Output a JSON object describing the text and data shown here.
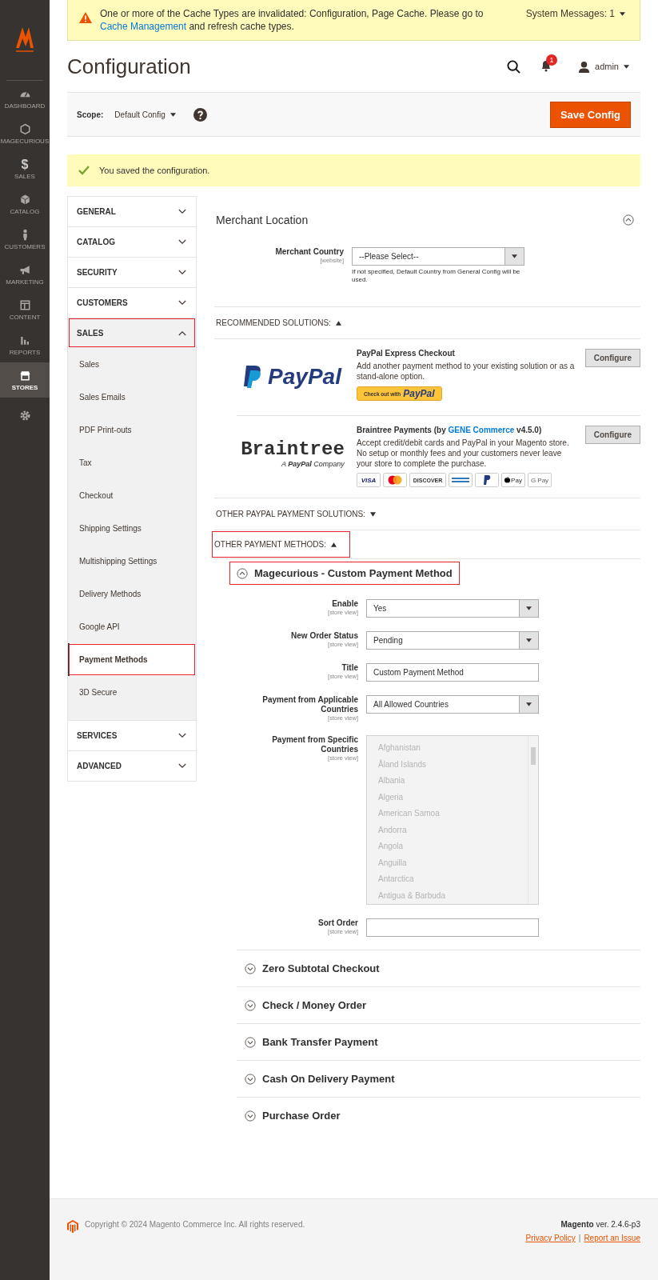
{
  "nav": {
    "items": [
      {
        "label": "DASHBOARD",
        "selected": false
      },
      {
        "label": "MAGECURIOUS",
        "selected": false
      },
      {
        "glyph": "$",
        "label": "SALES",
        "selected": false
      },
      {
        "label": "CATALOG",
        "selected": false
      },
      {
        "label": "CUSTOMERS",
        "selected": false
      },
      {
        "label": "MARKETING",
        "selected": false
      },
      {
        "label": "CONTENT",
        "selected": false
      },
      {
        "label": "REPORTS",
        "selected": false
      },
      {
        "label": "STORES",
        "selected": true
      },
      {
        "selected": false
      }
    ]
  },
  "system_message": {
    "text": "One or more of the Cache Types are invalidated: Configuration, Page Cache. Please go to",
    "link": "Cache Management",
    "text_end": "and refresh cache types.",
    "counter": "System Messages: 1"
  },
  "header": {
    "title": "Configuration",
    "notifications": "1",
    "user": "admin"
  },
  "scope": {
    "label": "Scope:",
    "value": "Default Config",
    "save_button": "Save Config"
  },
  "success_message": "You saved the configuration.",
  "config_nav": [
    {
      "label": "GENERAL",
      "expanded": false,
      "highlighted": false
    },
    {
      "label": "CATALOG",
      "expanded": false,
      "highlighted": false
    },
    {
      "label": "SECURITY",
      "expanded": false,
      "highlighted": false
    },
    {
      "label": "CUSTOMERS",
      "expanded": false,
      "highlighted": false
    },
    {
      "label": "SALES",
      "expanded": true,
      "highlighted": true,
      "children": [
        {
          "label": "Sales",
          "selected": false,
          "highlighted": false
        },
        {
          "label": "Sales Emails",
          "selected": false,
          "highlighted": false
        },
        {
          "label": "PDF Print-outs",
          "selected": false,
          "highlighted": false
        },
        {
          "label": "Tax",
          "selected": false,
          "highlighted": false
        },
        {
          "label": "Checkout",
          "selected": false,
          "highlighted": false
        },
        {
          "label": "Shipping Settings",
          "selected": false,
          "highlighted": false
        },
        {
          "label": "Multishipping Settings",
          "selected": false,
          "highlighted": false
        },
        {
          "label": "Delivery Methods",
          "selected": false,
          "highlighted": false
        },
        {
          "label": "Google API",
          "selected": false,
          "highlighted": false
        },
        {
          "label": "Payment Methods",
          "selected": true,
          "highlighted": true
        },
        {
          "label": "3D Secure",
          "selected": false,
          "highlighted": false
        }
      ]
    },
    {
      "label": "SERVICES",
      "expanded": false,
      "highlighted": false
    },
    {
      "label": "ADVANCED",
      "expanded": false,
      "highlighted": false
    }
  ],
  "merchant_location": {
    "title": "Merchant Location",
    "expanded": true,
    "label": "Merchant Country",
    "scope": "[website]",
    "value": "--Please Select--",
    "note": "If not specified, Default Country from General Config will be used."
  },
  "recommended": {
    "heading": "RECOMMENDED SOLUTIONS:",
    "expanded": true,
    "solutions": [
      {
        "kind": "paypal",
        "logo": "PayPal",
        "title": "PayPal Express Checkout",
        "description": "Add another payment method to your existing solution or as a stand-alone option.",
        "checkout_label": "Check out with",
        "checkout_brand": "PayPal",
        "button": "Configure"
      },
      {
        "kind": "braintree",
        "logo": "Braintree",
        "tagline": "A **PayPal** Company",
        "title": "Braintree Payments (by",
        "link": "GENE Commerce",
        "title_end": "v4.5.0)",
        "description": "Accept credit/debit cards and PayPal in your Magento store. No setup or monthly fees and your customers never leave your store to complete the purchase.",
        "button": "Configure",
        "cards": [
          {
            "kind": "visa",
            "label": "VISA"
          },
          {
            "kind": "mastercard"
          },
          {
            "kind": "discover",
            "label": "DISCOVER"
          },
          {
            "kind": "amex"
          },
          {
            "kind": "paypal"
          },
          {
            "kind": "applepay",
            "label": "Pay"
          },
          {
            "kind": "googlepay",
            "label": "G Pay"
          }
        ]
      }
    ]
  },
  "other_paypal": {
    "heading": "OTHER PAYPAL PAYMENT SOLUTIONS:",
    "expanded": false
  },
  "other_methods": {
    "heading": "OTHER PAYMENT METHODS:",
    "expanded": true,
    "highlighted": true,
    "groups": [
      {
        "title": "Magecurious - Custom Payment Method",
        "expanded": true,
        "highlighted": true,
        "fields": [
          {
            "kind": "select",
            "label": "Enable",
            "scope": "[store view]",
            "value": "Yes"
          },
          {
            "kind": "select",
            "label": "New Order Status",
            "scope": "[store view]",
            "value": "Pending"
          },
          {
            "kind": "text",
            "label": "Title",
            "scope": "[store view]",
            "value": "Custom Payment Method"
          },
          {
            "kind": "select",
            "label": "Payment from Applicable Countries",
            "scope": "[store view]",
            "value": "All Allowed Countries"
          },
          {
            "kind": "multiselect",
            "label": "Payment from Specific Countries",
            "scope": "[store view]",
            "disabled": true,
            "options": [
              "Afghanistan",
              "Åland Islands",
              "Albania",
              "Algeria",
              "American Samoa",
              "Andorra",
              "Angola",
              "Anguilla",
              "Antarctica",
              "Antigua & Barbuda"
            ]
          },
          {
            "kind": "text",
            "label": "Sort Order",
            "scope": "[store view]"
          }
        ]
      },
      {
        "title": "Zero Subtotal Checkout",
        "expanded": false,
        "highlighted": false
      },
      {
        "title": "Check / Money Order",
        "expanded": false,
        "highlighted": false
      },
      {
        "title": "Bank Transfer Payment",
        "expanded": false,
        "highlighted": false
      },
      {
        "title": "Cash On Delivery Payment",
        "expanded": false,
        "highlighted": false
      },
      {
        "title": "Purchase Order",
        "expanded": false,
        "highlighted": false
      }
    ]
  },
  "footer": {
    "copyright": "Copyright © 2024 Magento Commerce Inc. All rights reserved.",
    "version": "**Magento** ver. 2.4.6-p3",
    "links": [
      "Privacy Policy",
      "Report an Issue"
    ],
    "separator": "|"
  }
}
